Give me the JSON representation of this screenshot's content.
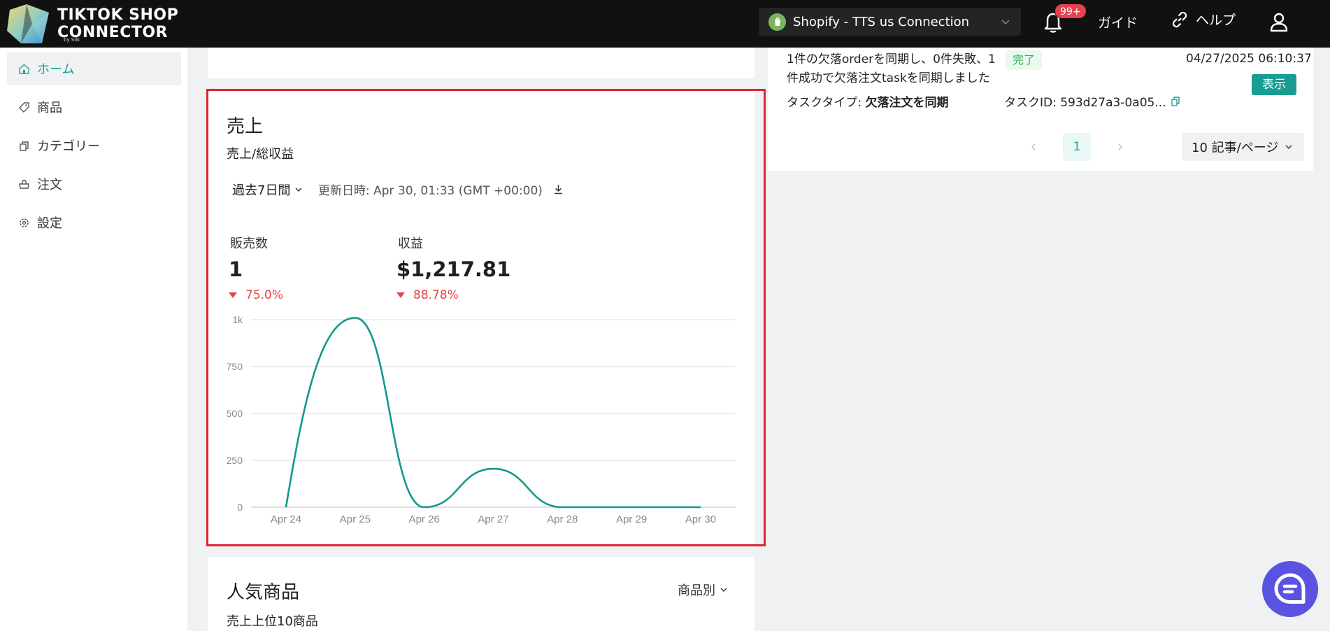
{
  "header": {
    "logo_line1": "TIKTOK SHOP",
    "logo_line2": "CONNECTOR",
    "logo_by": "by Silk",
    "store_name": "Shopify - TTS us Connection",
    "notif_badge": "99+",
    "guide_label": "ガイド",
    "help_label": "ヘルプ"
  },
  "sidebar": {
    "items": [
      {
        "label": "ホーム",
        "icon": "home-icon"
      },
      {
        "label": "商品",
        "icon": "tag-icon"
      },
      {
        "label": "カテゴリー",
        "icon": "copy-icon"
      },
      {
        "label": "注文",
        "icon": "cart-icon"
      },
      {
        "label": "設定",
        "icon": "gear-icon"
      }
    ]
  },
  "sales": {
    "title": "売上",
    "subtitle": "売上/総収益",
    "period_label": "過去7日間",
    "updated_text": "更新日時: Apr 30, 01:33 (GMT +00:00)",
    "metrics": [
      {
        "label": "販売数",
        "value": "1",
        "change": "75.0%"
      },
      {
        "label": "収益",
        "value": "$1,217.81",
        "change": "88.78%"
      }
    ]
  },
  "popular": {
    "title": "人気商品",
    "subtitle": "売上上位10商品",
    "sort_label": "商品別"
  },
  "task": {
    "message": "1件の欠落orderを同期し、0件失敗、1件成功で欠落注文taskを同期しました",
    "status": "完了",
    "time": "04/27/2025 06:10:37",
    "view_label": "表示",
    "type_label": "タスクタイプ:",
    "type_value": "欠落注文を同期",
    "id_text": "タスクID: 593d27a3-0a05..."
  },
  "pagination": {
    "current": "1",
    "page_size": "10 記事/ページ"
  },
  "colors": {
    "accent": "#1aa59a",
    "line": "#13998e",
    "negative": "#e0454c",
    "highlight": "#e0252c"
  },
  "chart_data": {
    "type": "line",
    "x": [
      "Apr 24",
      "Apr 25",
      "Apr 26",
      "Apr 27",
      "Apr 28",
      "Apr 29",
      "Apr 30"
    ],
    "series": [
      {
        "values": [
          0,
          1010,
          0,
          205,
          0,
          0,
          0
        ]
      }
    ],
    "yticks": [
      "0",
      "250",
      "500",
      "750",
      "1k"
    ],
    "ylim": [
      0,
      1000
    ],
    "smooth": true,
    "grid": true
  }
}
